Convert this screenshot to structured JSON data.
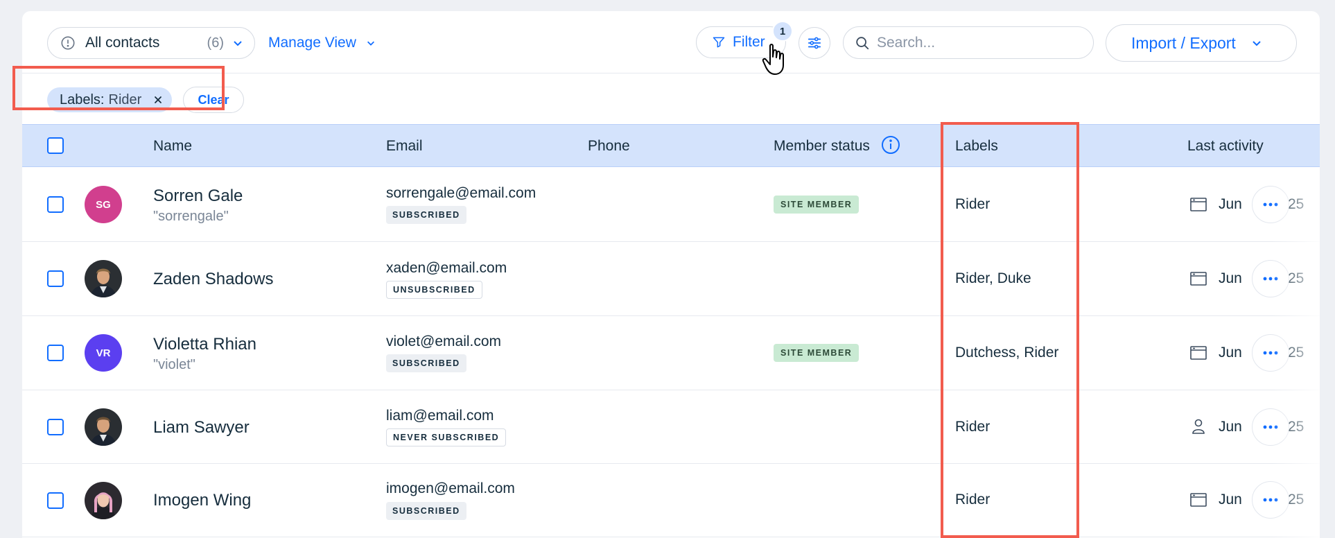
{
  "toolbar": {
    "view_label": "All contacts",
    "view_count": "(6)",
    "manage_view": "Manage View",
    "filter_label": "Filter",
    "filter_count": "1",
    "search_placeholder": "Search...",
    "import_export": "Import / Export"
  },
  "filters": {
    "chip_key": "Labels:",
    "chip_value": "Rider",
    "clear_label": "Clear"
  },
  "table": {
    "headers": {
      "name": "Name",
      "email": "Email",
      "phone": "Phone",
      "member_status": "Member status",
      "labels": "Labels",
      "last_activity": "Last activity"
    },
    "rows": [
      {
        "name": "Sorren Gale",
        "nickname": "\"sorrengale\"",
        "initials": "SG",
        "avatar_color": "#d13f8e",
        "email": "sorrengale@email.com",
        "subscription": "SUBSCRIBED",
        "member_status": "SITE MEMBER",
        "labels": "Rider",
        "activity_icon": "calendar-window-icon",
        "activity_text": "Jun",
        "activity_year": "25"
      },
      {
        "name": "Zaden Shadows",
        "nickname": "",
        "initials": "",
        "avatar_color": "",
        "email": "xaden@email.com",
        "subscription": "UNSUBSCRIBED",
        "member_status": "",
        "labels": "Rider, Duke",
        "activity_icon": "calendar-window-icon",
        "activity_text": "Jun",
        "activity_year": "25"
      },
      {
        "name": "Violetta Rhian",
        "nickname": "\"violet\"",
        "initials": "VR",
        "avatar_color": "#5b3ff0",
        "email": "violet@email.com",
        "subscription": "SUBSCRIBED",
        "member_status": "SITE MEMBER",
        "labels": "Dutchess, Rider",
        "activity_icon": "calendar-window-icon",
        "activity_text": "Jun",
        "activity_year": "25"
      },
      {
        "name": "Liam Sawyer",
        "nickname": "",
        "initials": "",
        "avatar_color": "",
        "email": "liam@email.com",
        "subscription": "NEVER SUBSCRIBED",
        "member_status": "",
        "labels": "Rider",
        "activity_icon": "person-icon",
        "activity_text": "Jun",
        "activity_year": "25"
      },
      {
        "name": "Imogen Wing",
        "nickname": "",
        "initials": "",
        "avatar_color": "",
        "email": "imogen@email.com",
        "subscription": "SUBSCRIBED",
        "member_status": "",
        "labels": "Rider",
        "activity_icon": "calendar-window-icon",
        "activity_text": "Jun",
        "activity_year": "25"
      }
    ]
  },
  "colors": {
    "accent": "#116dff",
    "highlight": "#f25c4e",
    "header_bg": "#d4e3fc",
    "member_badge": "#c9ead3"
  }
}
